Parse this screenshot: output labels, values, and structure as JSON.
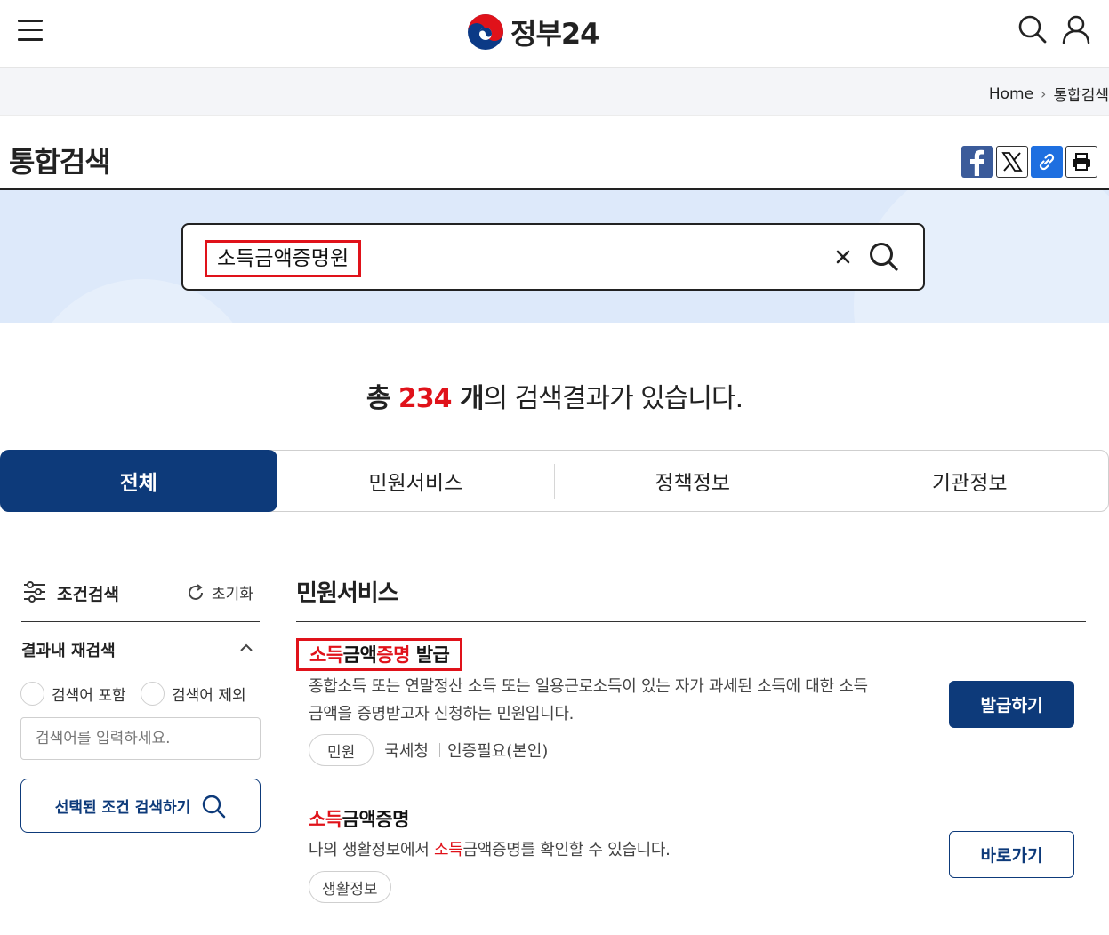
{
  "header": {
    "logo_text": "정부24",
    "menu_icon": "hamburger-menu-icon",
    "search_icon": "search-icon",
    "user_icon": "user-icon"
  },
  "breadcrumb": {
    "home": "Home",
    "current": "통합검색"
  },
  "page": {
    "title": "통합검색"
  },
  "share": {
    "facebook": "facebook-icon",
    "x": "x-icon",
    "link": "link-icon",
    "print": "print-icon"
  },
  "search": {
    "value": "소득금액증명원"
  },
  "result_summary": {
    "prefix": "총 ",
    "count": "234",
    "unit": " 개",
    "suffix": "의 검색결과가 있습니다."
  },
  "tabs": [
    {
      "label": "전체",
      "active": true
    },
    {
      "label": "민원서비스",
      "active": false
    },
    {
      "label": "정책정보",
      "active": false
    },
    {
      "label": "기관정보",
      "active": false
    }
  ],
  "filter": {
    "title": "조건검색",
    "reset_label": "초기화",
    "section_title": "결과내 재검색",
    "include_label": "검색어 포함",
    "exclude_label": "검색어 제외",
    "keyword_placeholder": "검색어를 입력하세요.",
    "submit_label": "선택된 조건 검색하기"
  },
  "results": {
    "section_title": "민원서비스",
    "items": [
      {
        "title_hl1": "소득",
        "title_mid": "금액",
        "title_hl2": "증명",
        "title_rest": " 발급",
        "description_line1": "종합소득 또는 연말정산 소득 또는 일용근로소득이 있는 자가 과세된 소득에 대한 소득",
        "description_line2": "금액을 증명받고자 신청하는 민원입니다.",
        "chip": "민원",
        "agency": "국세청",
        "auth": "인증필요(본인)",
        "button_label": "발급하기"
      },
      {
        "title_hl": "소득",
        "title_rest": "금액증명",
        "description_pre": "나의 생활정보에서 ",
        "description_hl": "소득",
        "description_post": "금액증명를 확인할 수 있습니다.",
        "chip": "생활정보",
        "button_label": "바로가기"
      }
    ]
  },
  "colors": {
    "primary": "#0d3a7a",
    "highlight": "#e0121a",
    "band": "#dde9fa"
  }
}
